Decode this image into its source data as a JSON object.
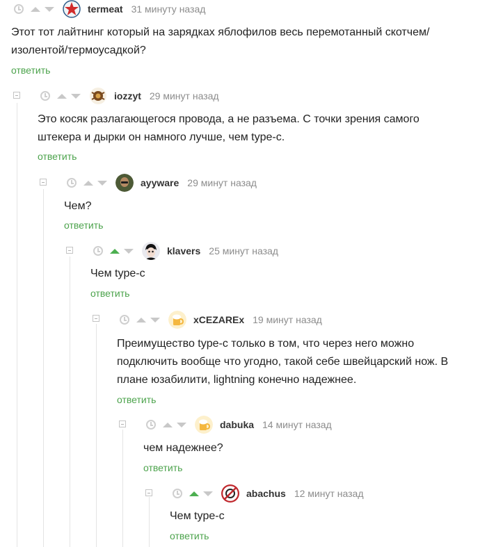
{
  "comments": [
    {
      "username": "termeat",
      "time": "31 минуту назад",
      "avatar_icon": "red-star-avatar",
      "lines": [
        "Этот тот лайтнинг который на зарядках яблофилов весь перемотанный скотчем/",
        "изолентой/термоусадкой?"
      ],
      "reply": "ответить"
    },
    {
      "username": "iozzyt",
      "time": "29 минут назад",
      "avatar_icon": "emblem-avatar",
      "lines": [
        "Это косяк разлагающегося провода, а не разъема. С точки зрения самого",
        "штекера и дырки он намного лучше, чем type-c."
      ],
      "reply": "ответить"
    },
    {
      "username": "ayyware",
      "time": "29 минут назад",
      "avatar_icon": "photo-avatar",
      "lines": [
        "Чем?"
      ],
      "reply": "ответить"
    },
    {
      "username": "klavers",
      "time": "25 минут назад",
      "avatar_icon": "character-avatar",
      "lines": [
        "Чем type-c"
      ],
      "reply": "ответить"
    },
    {
      "username": "xCEZAREx",
      "time": "19 минут назад",
      "avatar_icon": "beer-avatar",
      "lines": [
        "Преимущество type-c только в том, что через него можно",
        "подключить вообще что угодно, такой себе швейцарский нож. В",
        "плане юзабилити, lightning конечно надежнее."
      ],
      "reply": "ответить"
    },
    {
      "username": "dabuka",
      "time": "14 минут назад",
      "avatar_icon": "beer-avatar",
      "lines": [
        "чем надежнее?"
      ],
      "reply": "ответить"
    },
    {
      "username": "abachus",
      "time": "12 минут назад",
      "avatar_icon": "forbidden-sign-avatar",
      "lines": [
        "Чем type-c"
      ],
      "reply": "ответить"
    }
  ],
  "colors": {
    "reply_link": "#4ca34c",
    "upvoted_arrow": "#4caf50",
    "muted": "#c8c8c8"
  }
}
